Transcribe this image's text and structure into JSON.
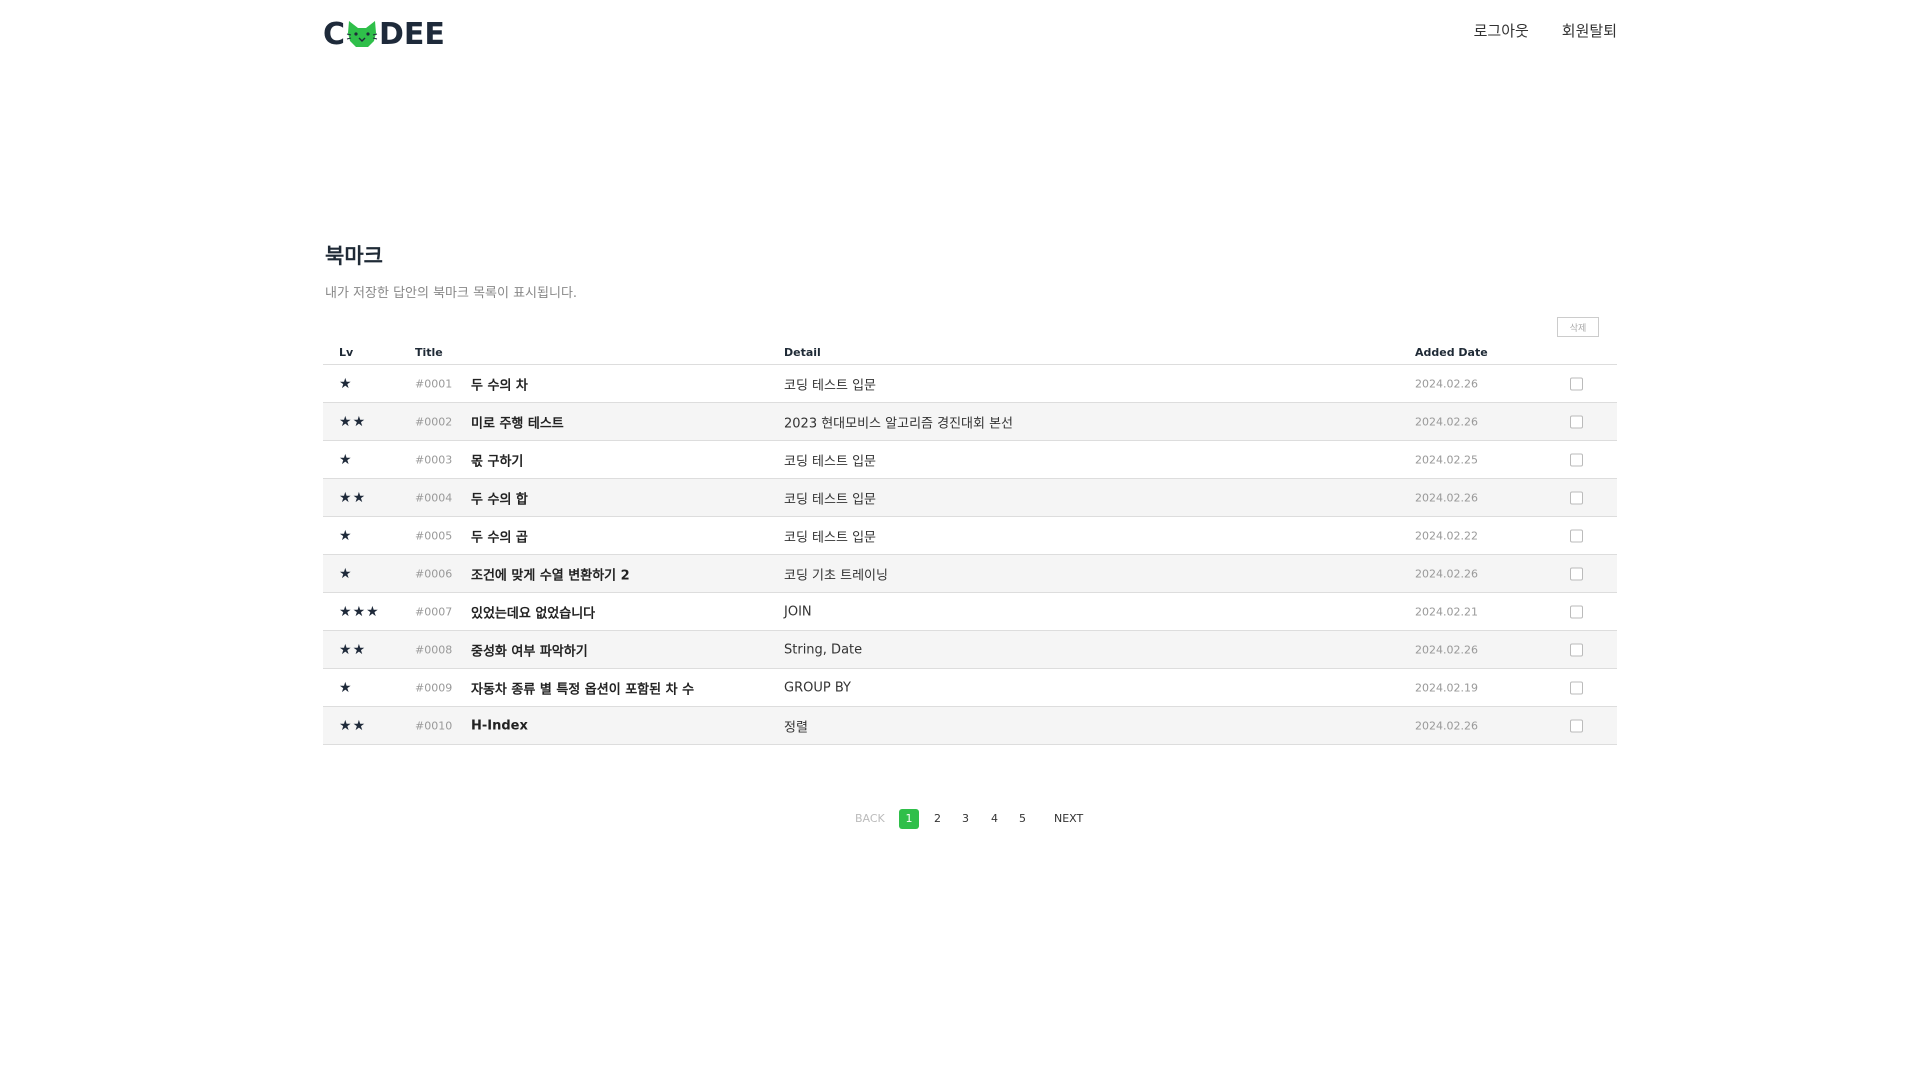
{
  "header": {
    "logo_left": "C",
    "logo_right": "DEE",
    "nav": [
      "로그아웃",
      "회원탈퇴"
    ]
  },
  "page": {
    "title": "북마크",
    "subtitle": "내가 저장한 답안의 북마크 목록이 표시됩니다.",
    "delete_label": "삭제"
  },
  "table": {
    "headers": {
      "lv": "Lv",
      "title": "Title",
      "detail": "Detail",
      "date": "Added Date"
    },
    "rows": [
      {
        "level": 1,
        "number": "#0001",
        "title": "두 수의 차",
        "detail": "코딩 테스트 입문",
        "date": "2024.02.26"
      },
      {
        "level": 2,
        "number": "#0002",
        "title": "미로 주행 테스트",
        "detail": "2023 현대모비스 알고리즘 경진대회 본선",
        "date": "2024.02.26"
      },
      {
        "level": 1,
        "number": "#0003",
        "title": "몫 구하기",
        "detail": "코딩 테스트 입문",
        "date": "2024.02.25"
      },
      {
        "level": 2,
        "number": "#0004",
        "title": "두 수의 합",
        "detail": "코딩 테스트 입문",
        "date": "2024.02.26"
      },
      {
        "level": 1,
        "number": "#0005",
        "title": "두 수의 곱",
        "detail": "코딩 테스트 입문",
        "date": "2024.02.22"
      },
      {
        "level": 1,
        "number": "#0006",
        "title": "조건에 맞게 수열 변환하기 2",
        "detail": "코딩 기초 트레이닝",
        "date": "2024.02.26"
      },
      {
        "level": 3,
        "number": "#0007",
        "title": "있었는데요 없었습니다",
        "detail": "JOIN",
        "date": "2024.02.21"
      },
      {
        "level": 2,
        "number": "#0008",
        "title": "중성화 여부 파악하기",
        "detail": "String, Date",
        "date": "2024.02.26"
      },
      {
        "level": 1,
        "number": "#0009",
        "title": "자동차 종류 별 특정 옵션이 포함된 차 수",
        "detail": "GROUP BY",
        "date": "2024.02.19"
      },
      {
        "level": 2,
        "number": "#0010",
        "title": "H-Index",
        "detail": "정렬",
        "date": "2024.02.26"
      }
    ]
  },
  "pagination": {
    "back": "BACK",
    "pages": [
      "1",
      "2",
      "3",
      "4",
      "5"
    ],
    "current": "1",
    "next": "NEXT"
  },
  "colors": {
    "accent": "#2fbf4a",
    "logo_text": "#1e2a3a",
    "row_alt": "#f5f5f5"
  },
  "icons": {
    "level": "star-icon",
    "mascot": "cat-mascot-icon"
  }
}
